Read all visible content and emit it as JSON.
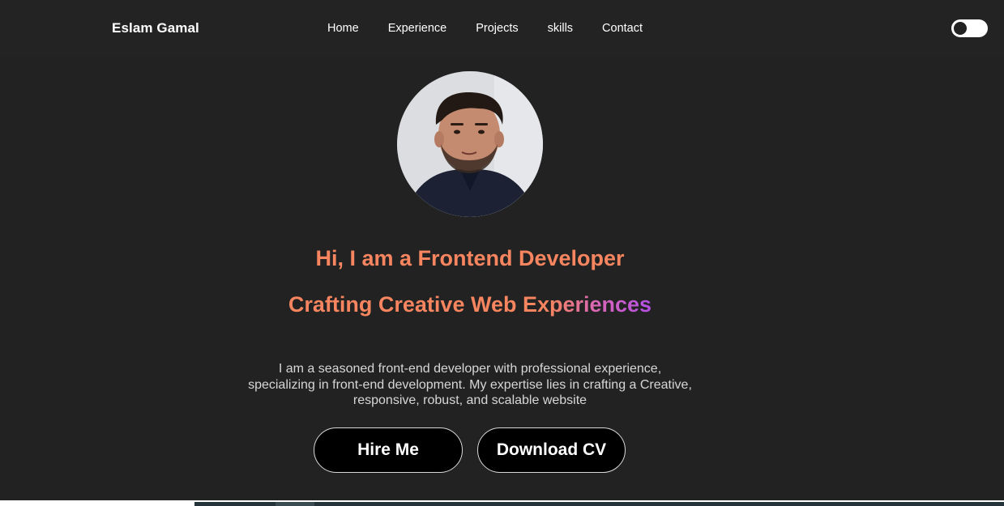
{
  "brand": {
    "name": "Eslam Gamal"
  },
  "nav": {
    "items": [
      {
        "label": "Home"
      },
      {
        "label": "Experience"
      },
      {
        "label": "Projects"
      },
      {
        "label": "skills"
      },
      {
        "label": "Contact"
      }
    ]
  },
  "theme_toggle": {
    "state": "dark"
  },
  "hero": {
    "headline_1": "Hi, I am a Frontend Developer",
    "headline_2": "Crafting Creative Web Experiences",
    "intro_lines": [
      "I am a seasoned front-end developer with professional experience,",
      "specializing in front-end development. My expertise lies in crafting a Creative,",
      "responsive, robust, and scalable website"
    ],
    "buttons": {
      "hire": "Hire Me",
      "download": "Download CV"
    }
  },
  "colors": {
    "background": "#222222",
    "accent_orange": "#f7855f",
    "accent_purple": "#b44fe6",
    "button_bg": "#000000",
    "text_white": "#ffffff"
  },
  "icons": {
    "avatar": "profile-photo"
  }
}
